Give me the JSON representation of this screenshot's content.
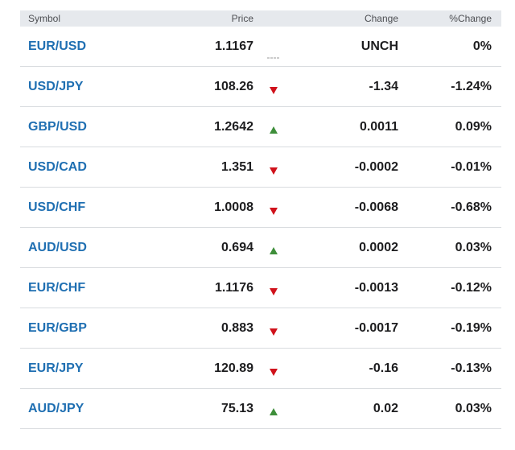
{
  "header": {
    "symbol": "Symbol",
    "price": "Price",
    "change": "Change",
    "pct_change": "%Change"
  },
  "colors": {
    "symbol_link": "#1f6fb2",
    "up": "#3e8e3a",
    "down": "#d0121b",
    "unchanged": "#9a9a9a"
  },
  "rows": [
    {
      "symbol": "EUR/USD",
      "price": "1.1167",
      "direction": "unchanged",
      "change": "UNCH",
      "pct": "0%"
    },
    {
      "symbol": "USD/JPY",
      "price": "108.26",
      "direction": "down",
      "change": "-1.34",
      "pct": "-1.24%"
    },
    {
      "symbol": "GBP/USD",
      "price": "1.2642",
      "direction": "up",
      "change": "0.0011",
      "pct": "0.09%"
    },
    {
      "symbol": "USD/CAD",
      "price": "1.351",
      "direction": "down",
      "change": "-0.0002",
      "pct": "-0.01%"
    },
    {
      "symbol": "USD/CHF",
      "price": "1.0008",
      "direction": "down",
      "change": "-0.0068",
      "pct": "-0.68%"
    },
    {
      "symbol": "AUD/USD",
      "price": "0.694",
      "direction": "up",
      "change": "0.0002",
      "pct": "0.03%"
    },
    {
      "symbol": "EUR/CHF",
      "price": "1.1176",
      "direction": "down",
      "change": "-0.0013",
      "pct": "-0.12%"
    },
    {
      "symbol": "EUR/GBP",
      "price": "0.883",
      "direction": "down",
      "change": "-0.0017",
      "pct": "-0.19%"
    },
    {
      "symbol": "EUR/JPY",
      "price": "120.89",
      "direction": "down",
      "change": "-0.16",
      "pct": "-0.13%"
    },
    {
      "symbol": "AUD/JPY",
      "price": "75.13",
      "direction": "up",
      "change": "0.02",
      "pct": "0.03%"
    }
  ]
}
